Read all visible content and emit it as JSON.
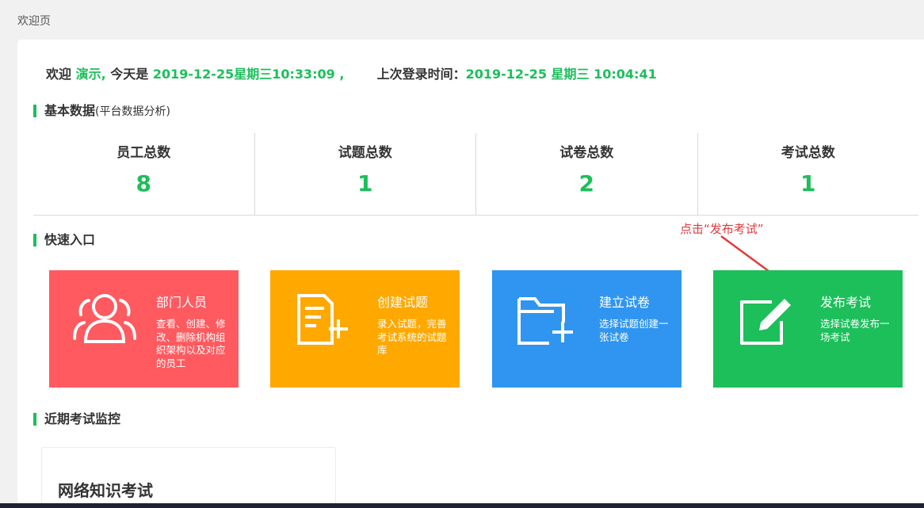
{
  "breadcrumb": "欢迎页",
  "welcome": {
    "prefix": "欢迎",
    "user": "演示,",
    "today_label": "今天是",
    "today_value": "2019-12-25星期三10:33:09 ,",
    "last_login_label": "上次登录时间：",
    "last_login_value": "2019-12-25 星期三 10:04:41"
  },
  "basic_data": {
    "title": "基本数据",
    "subtitle": "(平台数据分析)",
    "stats": [
      {
        "label": "员工总数",
        "value": "8"
      },
      {
        "label": "试题总数",
        "value": "1"
      },
      {
        "label": "试卷总数",
        "value": "2"
      },
      {
        "label": "考试总数",
        "value": "1"
      }
    ]
  },
  "quick_entry": {
    "title": "快速入口",
    "tiles": [
      {
        "title": "部门人员",
        "desc": "查看、创建、修改、删除机构组织架构以及对应的员工",
        "color": "#ff5a5f",
        "icon": "users-icon"
      },
      {
        "title": "创建试题",
        "desc": "录入试题，完善考试系统的试题库",
        "color": "#ffa800",
        "icon": "document-add-icon"
      },
      {
        "title": "建立试卷",
        "desc": "选择试题创建一张试卷",
        "color": "#2f95f0",
        "icon": "folder-add-icon"
      },
      {
        "title": "发布考试",
        "desc": "选择试卷发布一场考试",
        "color": "#1cbf5a",
        "icon": "edit-icon"
      }
    ]
  },
  "annotation": "点击“发布考试”",
  "recent_exams": {
    "title": "近期考试监控",
    "items": [
      {
        "name": "网络知识考试"
      }
    ]
  },
  "colors": {
    "accent": "#1cbf5a",
    "annotation": "#e4393c"
  }
}
